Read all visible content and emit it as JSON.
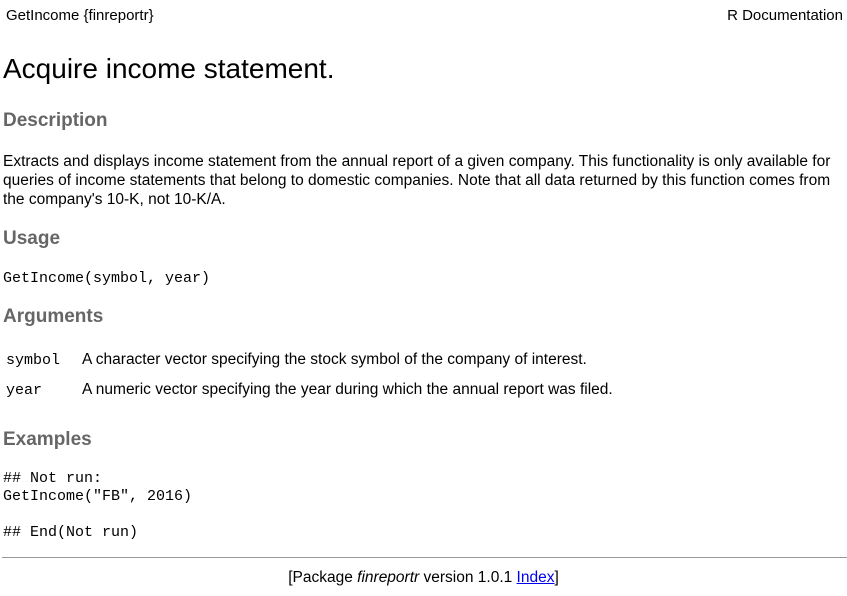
{
  "header": {
    "topic": "GetIncome {finreportr}",
    "doc_label": "R Documentation"
  },
  "title": "Acquire income statement.",
  "description": {
    "heading": "Description",
    "text": "Extracts and displays income statement from the annual report of a given company. This functionality is only available for queries of income statements that belong to domestic companies. Note that all data returned by this function comes from the company's 10-K, not 10-K/A."
  },
  "usage": {
    "heading": "Usage",
    "code": "GetIncome(symbol, year)"
  },
  "arguments": {
    "heading": "Arguments",
    "items": [
      {
        "name": "symbol",
        "description": "A character vector specifying the stock symbol of the company of interest."
      },
      {
        "name": "year",
        "description": "A numeric vector specifying the year during which the annual report was filed."
      }
    ]
  },
  "examples": {
    "heading": "Examples",
    "code": "## Not run:\nGetIncome(\"FB\", 2016)\n\n## End(Not run)"
  },
  "footer": {
    "prefix": "[Package ",
    "package_name": "finreportr",
    "version_text": " version 1.0.1 ",
    "index_link": "Index",
    "suffix": "]"
  }
}
